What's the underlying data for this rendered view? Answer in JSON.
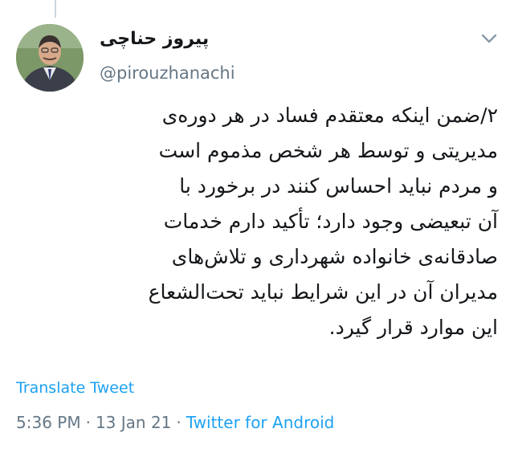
{
  "author": {
    "display_name": "پیروز حناچی",
    "handle": "@pirouzhanachi",
    "avatar_icon": "profile-photo"
  },
  "menu_icon": "chevron-down-icon",
  "tweet": {
    "lines": [
      "۲/ضمن اینکه معتقدم فساد در هر دوره‌ی",
      "مدیریتی و توسط هر شخص مذموم است",
      "و مردم نباید احساس کنند در برخورد با",
      "آن تبعیضی وجود دارد؛ تأکید دارم خدمات",
      "صادقانه‌ی خانواده شهرداری و تلاش‌های",
      "مدیران آن در این شرایط نباید تحت‌الشعاع",
      "این موارد قرار گیرد."
    ]
  },
  "translate_label": "Translate Tweet",
  "meta": {
    "time": "5:36 PM",
    "separator": "·",
    "date": "13 Jan 21",
    "source": "Twitter for Android"
  },
  "colors": {
    "link": "#1da1f2",
    "secondary": "#657786",
    "text": "#14171a"
  }
}
